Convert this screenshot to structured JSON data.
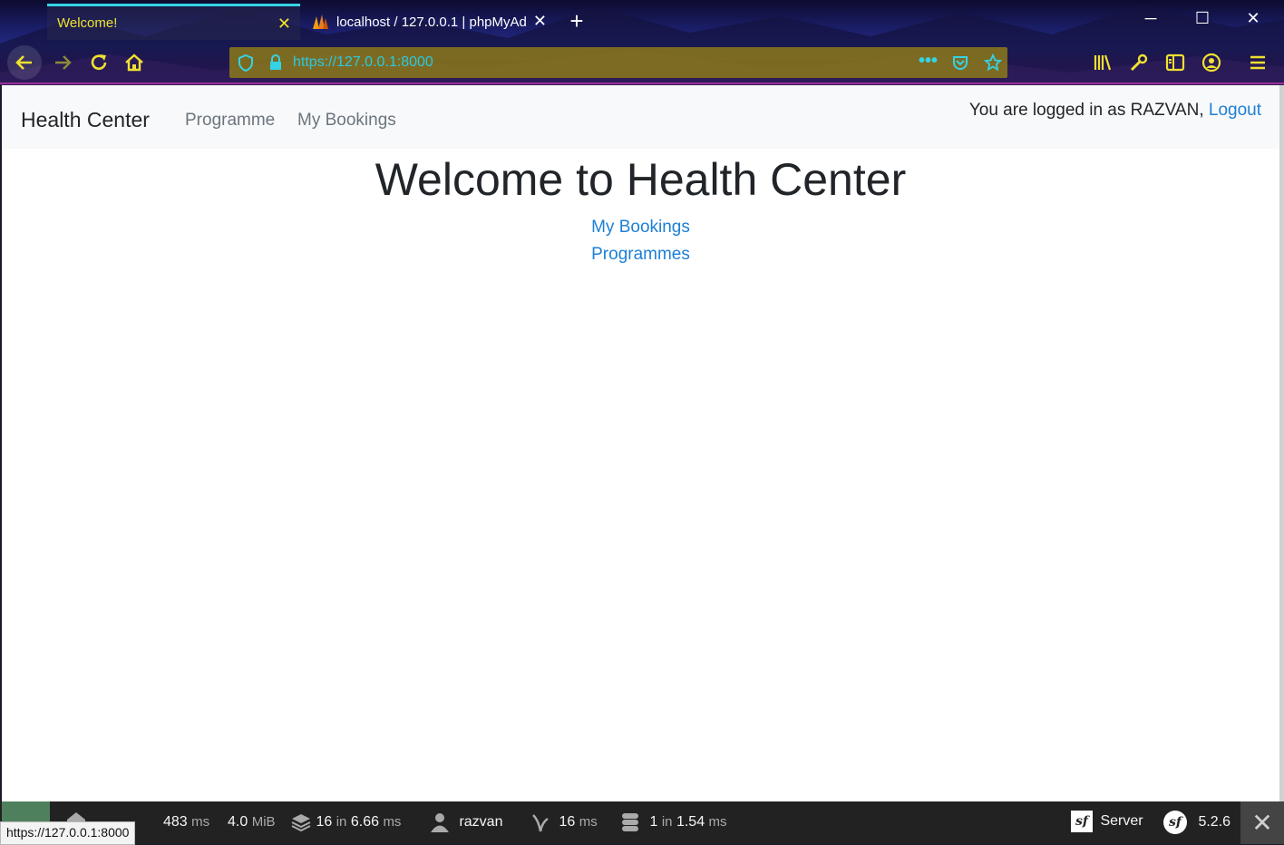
{
  "browser": {
    "tabs": [
      {
        "title": "Welcome!",
        "active": true
      },
      {
        "title": "localhost / 127.0.0.1 | phpMyAd",
        "active": false
      }
    ],
    "url": "https://127.0.0.1:8000",
    "accent_color": "#f0e030",
    "icons": [
      "back-icon",
      "forward-icon",
      "reload-icon",
      "home-icon",
      "shield-icon",
      "lock-icon",
      "more-icon",
      "pocket-icon",
      "star-icon",
      "library-icon",
      "wrench-icon",
      "sidebar-icon",
      "account-icon",
      "menu-icon",
      "new-tab-icon",
      "minimize-icon",
      "maximize-icon",
      "close-window-icon"
    ]
  },
  "site": {
    "brand": "Health Center",
    "nav": {
      "programme": "Programme",
      "bookings": "My Bookings"
    },
    "login": {
      "prefix": "You are logged in as RAZVAN,",
      "logout": "Logout"
    },
    "heading": "Welcome to Health Center",
    "links": {
      "bookings": "My Bookings",
      "programmes": "Programmes"
    },
    "link_color": "#1e7fd6"
  },
  "debug_toolbar": {
    "time_value": "483",
    "time_unit": "ms",
    "memory_value": "4.0",
    "memory_unit": "MiB",
    "cache": {
      "count": "16",
      "in": "in",
      "time": "6.66",
      "unit": "ms"
    },
    "user": "razvan",
    "twig": {
      "value": "16",
      "unit": "ms"
    },
    "db": {
      "count": "1",
      "in": "in",
      "time": "1.54",
      "unit": "ms"
    },
    "server_label": "Server",
    "symfony_version": "5.2.6",
    "status_color": "#4f805d"
  },
  "status_url": "https://127.0.0.1:8000"
}
